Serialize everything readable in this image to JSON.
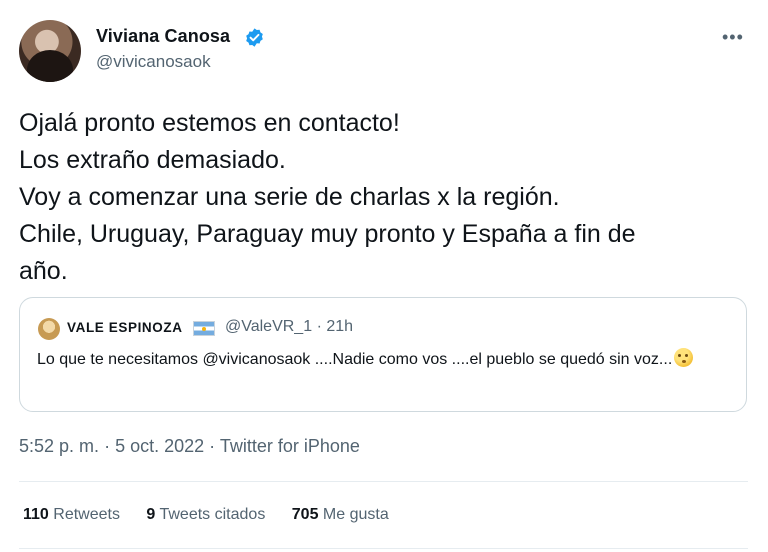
{
  "author": {
    "display_name": "Viviana Canosa",
    "handle": "@vivicanosaok",
    "verified_color": "#1d9bf0",
    "avatar_icon": "profile-photo"
  },
  "menu": {
    "more_label": "•••"
  },
  "tweet": {
    "lines": [
      "Ojalá pronto estemos en contacto!",
      "Los extraño demasiado.",
      "Voy a comenzar una serie de charlas x la región.",
      "Chile, Uruguay, Paraguay muy pronto y España a fin de",
      "año."
    ]
  },
  "quote": {
    "display_name": "VALE ESPINOZA",
    "flag_icon": "argentina-flag",
    "handle": "@ValeVR_1",
    "separator": "·",
    "time": "21h",
    "text": "Lo que te necesitamos @vivicanosaok ....Nadie como vos ....el pueblo se quedó sin voz...",
    "emoji_icon": "face-with-rolling-eyes"
  },
  "meta": {
    "time": "5:52 p. m.",
    "date": "5 oct. 2022",
    "source": "Twitter for iPhone",
    "separator": "·"
  },
  "stats": {
    "retweets_count": "110",
    "retweets_label": "Retweets",
    "quotes_count": "9",
    "quotes_label": "Tweets citados",
    "likes_count": "705",
    "likes_label": "Me gusta"
  }
}
